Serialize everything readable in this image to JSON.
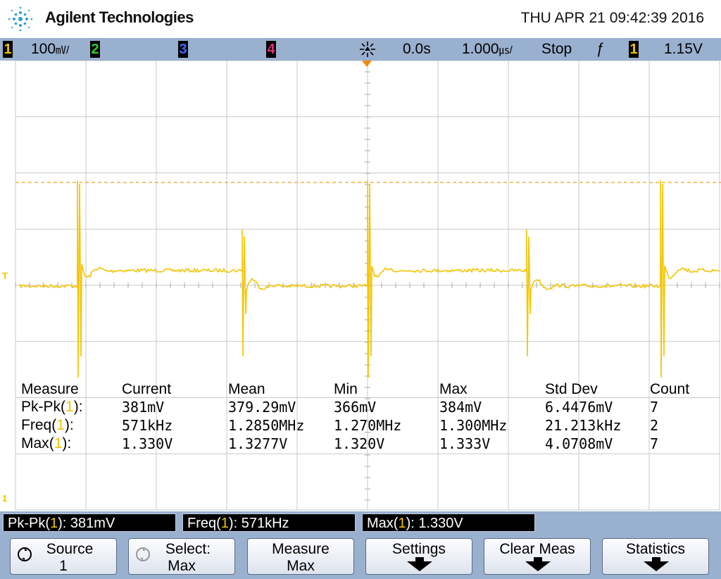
{
  "header": {
    "brand": "Agilent Technologies",
    "datetime": "THU APR 21 09:42:39 2016"
  },
  "status": {
    "ch1_num": "1",
    "ch1_scale": "100",
    "ch1_unit": "㎷/",
    "ch2_num": "2",
    "ch3_num": "3",
    "ch4_num": "4",
    "delay": "0.0s",
    "timebase": "1.000",
    "timebase_unit": "㎲/",
    "run_state": "Stop",
    "trigger_slope": "ƒ",
    "trig_ch": "1",
    "trig_level": "1.15V",
    "colors": {
      "ch1": "#f2c200",
      "ch2": "#33cc33",
      "ch3": "#3a6cff",
      "ch4": "#e0307a"
    }
  },
  "screen": {
    "trigger_marker": "T",
    "ground_marker": "1",
    "waveform_color": "#f5c400"
  },
  "measurements": {
    "headers": [
      "Measure",
      "Current",
      "Mean",
      "Min",
      "Max",
      "Std Dev",
      "Count"
    ],
    "rows": [
      {
        "name": "Pk-Pk",
        "ch": "1",
        "current": "381mV",
        "mean": "379.29mV",
        "min": "366mV",
        "max": "384mV",
        "stddev": "6.4476mV",
        "count": "7"
      },
      {
        "name": "Freq",
        "ch": "1",
        "current": "571kHz",
        "mean": "1.2850MHz",
        "min": "1.270MHz",
        "max": "1.300MHz",
        "stddev": "21.213kHz",
        "count": "2"
      },
      {
        "name": "Max",
        "ch": "1",
        "current": "1.330V",
        "mean": "1.3277V",
        "min": "1.320V",
        "max": "1.333V",
        "stddev": "4.0708mV",
        "count": "7"
      }
    ]
  },
  "measbar": [
    {
      "name": "Pk-Pk",
      "ch": "1",
      "value": "381mV"
    },
    {
      "name": "Freq",
      "ch": "1",
      "value": "571kHz"
    },
    {
      "name": "Max",
      "ch": "1",
      "value": "1.330V"
    }
  ],
  "softkeys": [
    {
      "line1": "Source",
      "line2": "1"
    },
    {
      "line1": "Select:",
      "line2": "Max"
    },
    {
      "line1": "Measure",
      "line2": "Max"
    },
    {
      "line1": "Settings",
      "line2": ""
    },
    {
      "line1": "Clear Meas",
      "line2": ""
    },
    {
      "line1": "Statistics",
      "line2": ""
    }
  ]
}
